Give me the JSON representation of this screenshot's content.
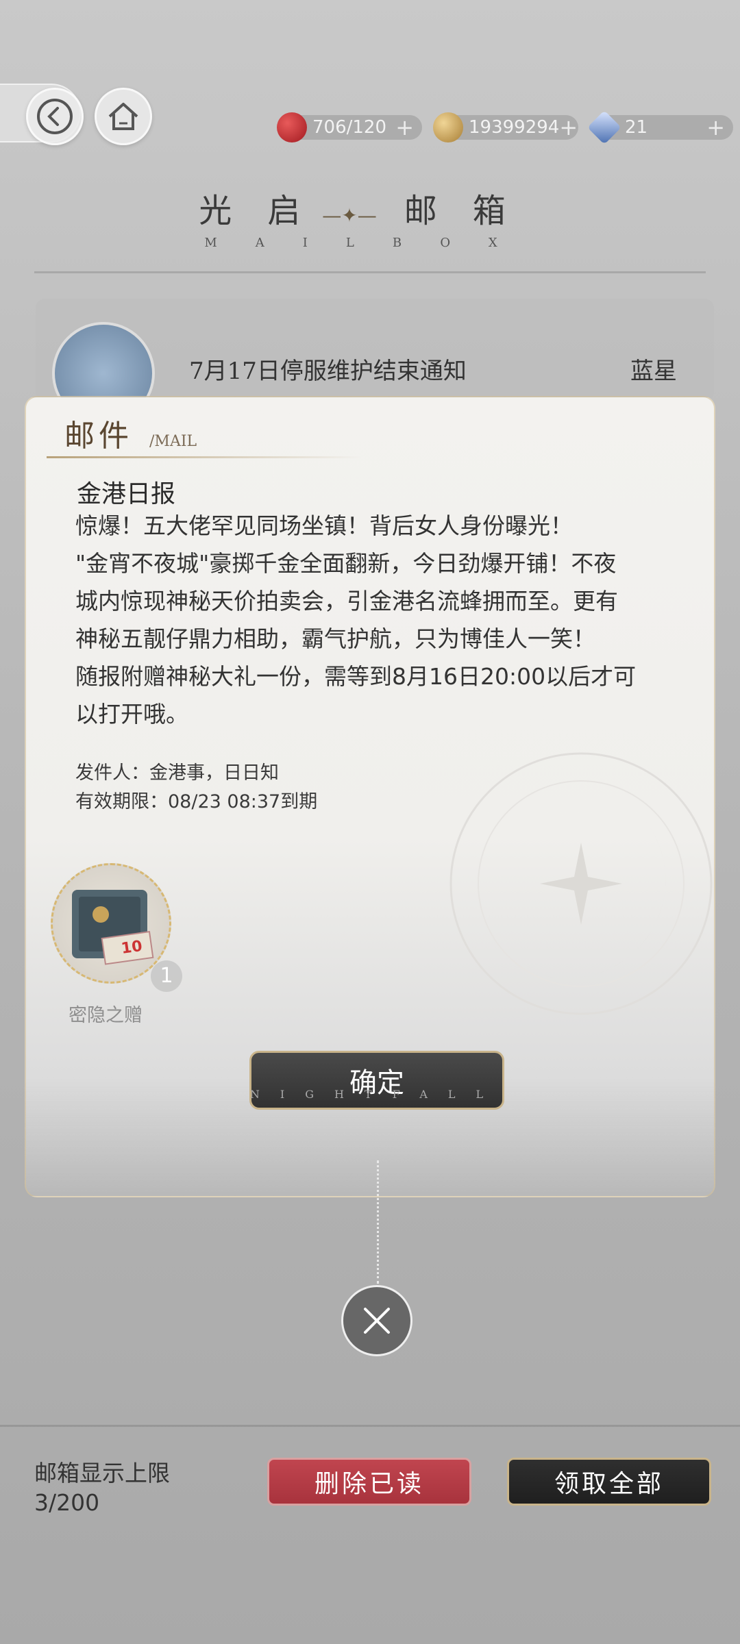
{
  "resources": [
    {
      "icon": "apple-stamina-icon",
      "value": "706/120",
      "color": "#c8242a"
    },
    {
      "icon": "gold-coin-icon",
      "value": "19399294",
      "color": "#c9a45a"
    },
    {
      "icon": "blue-crystal-icon",
      "value": "21",
      "color": "#4a6fb0"
    }
  ],
  "header": {
    "title_left": "光启",
    "title_right": "邮箱",
    "subtitle": "MAILBOX"
  },
  "mail_list": {
    "item_title": "7月17日停服维护结束通知",
    "item_sender": "蓝星"
  },
  "modal": {
    "label": "邮件",
    "label_en": "/MAIL",
    "sender_title": "金港日报",
    "body_lines": [
      "惊爆！五大佬罕见同场坐镇！背后女人身份曝光！",
      "\"金宵不夜城\"豪掷千金全面翻新，今日劲爆开铺！不夜",
      "城内惊现神秘天价拍卖会，引金港名流蜂拥而至。更有",
      "神秘五靓仔鼎力相助，霸气护航，只为博佳人一笑！",
      "随报附赠神秘大礼一份，需等到8月16日20:00以后才可",
      "以打开哦。"
    ],
    "from_line": "发件人：金港事，日日知",
    "expire_line": "有效期限：08/23 08:37到期",
    "reward": {
      "name": "密隐之赠",
      "count": "1",
      "icon": "safe-box-icon"
    },
    "confirm_label": "确定",
    "confirm_sub": "NIGHTFALL"
  },
  "bottom": {
    "limit_label": "邮箱显示上限",
    "limit_value": "3/200",
    "delete_label": "删除已读",
    "claim_label": "领取全部"
  }
}
